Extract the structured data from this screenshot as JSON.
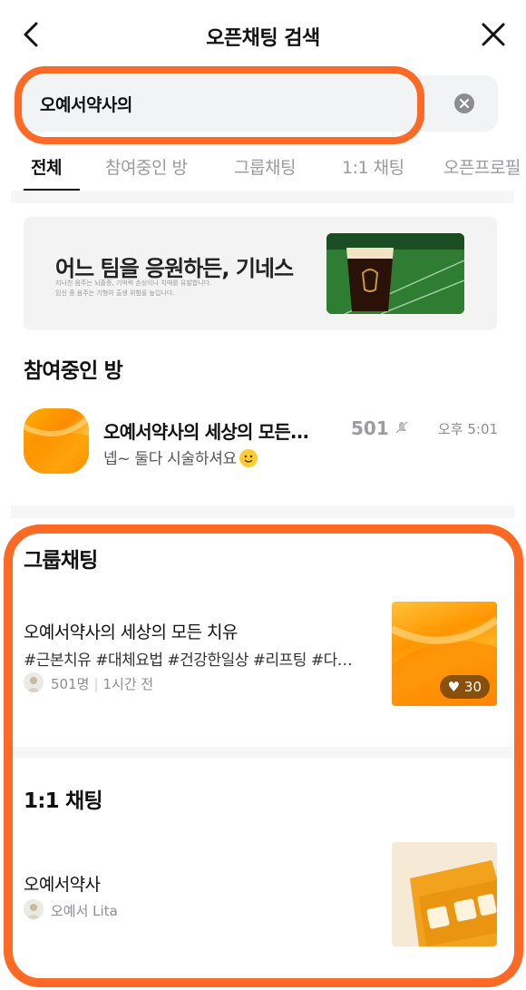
{
  "header": {
    "title": "오픈채팅 검색",
    "back_icon": "chevron-left-icon",
    "close_icon": "close-icon"
  },
  "search": {
    "value": "오예서약사의",
    "clear_icon": "clear-circle-icon"
  },
  "tabs": [
    {
      "label": "전체",
      "active": true
    },
    {
      "label": "참여중인 방",
      "active": false
    },
    {
      "label": "그룹채팅",
      "active": false
    },
    {
      "label": "1:1 채팅",
      "active": false
    },
    {
      "label": "오픈프로필",
      "active": false
    }
  ],
  "ad": {
    "headline": "어느 팀을 응원하든, 기네스",
    "fine_print_1": "지나친 음주는 뇌졸중, 기억력 손상이나 치매를 유발합니다.",
    "fine_print_2": "임신 중 음주는 기형아 출생 위험을 높입니다."
  },
  "joined": {
    "section_title": "참여중인 방",
    "room": {
      "title": "오예서약사의 세상의 모든...",
      "member_count": "501",
      "time": "오후 5:01",
      "last_message": "넵~ 둘다 시술하셔요"
    }
  },
  "group": {
    "section_title": "그룹채팅",
    "item": {
      "title": "오예서약사의 세상의 모든 치유",
      "tags": "#근본치유 #대체요법 #건강한일상 #리프팅 #다…",
      "members": "501명",
      "last_active": "1시간 전",
      "likes": "30"
    }
  },
  "one_on_one": {
    "section_title": "1:1 채팅",
    "item": {
      "title": "오예서약사",
      "owner": "오예서 Lita"
    }
  },
  "colors": {
    "highlight": "#fe6a26",
    "tab_inactive": "#9a9a9f",
    "meta": "#8d8d92"
  }
}
